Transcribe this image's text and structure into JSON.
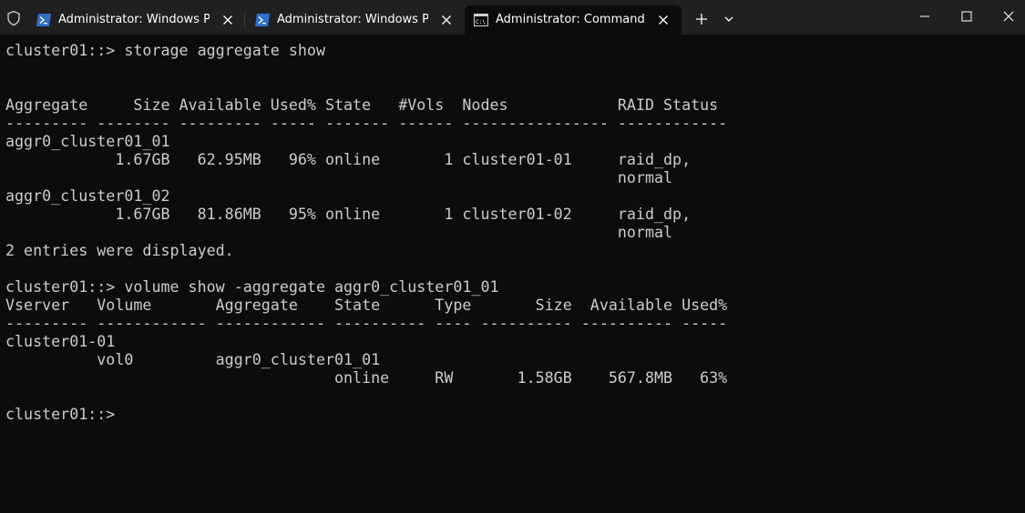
{
  "tabs": [
    {
      "title": "Administrator: Windows PowerShell",
      "icon": "powershell-icon",
      "active": false
    },
    {
      "title": "Administrator: Windows PowerShell",
      "icon": "powershell-icon",
      "active": false
    },
    {
      "title": "Administrator: Command Prompt",
      "icon": "command-prompt-icon",
      "active": true
    }
  ],
  "toolbar": {
    "new_tab_icon": "plus-icon",
    "dropdown_icon": "chevron-down-icon",
    "shield_icon": "shield-icon"
  },
  "window_controls": [
    "minimize-icon",
    "maximize-icon",
    "close-icon"
  ],
  "colors": {
    "titlebar": "#202020",
    "terminal_bg": "#0c0c0c",
    "terminal_text": "#cccccc"
  },
  "terminal": {
    "lines": [
      "cluster01::> storage aggregate show",
      "",
      "",
      "Aggregate     Size Available Used% State   #Vols  Nodes            RAID Status",
      "--------- -------- --------- ----- ------- ------ ---------------- ------------",
      "aggr0_cluster01_01",
      "            1.67GB   62.95MB   96% online       1 cluster01-01     raid_dp,",
      "                                                                   normal",
      "aggr0_cluster01_02",
      "            1.67GB   81.86MB   95% online       1 cluster01-02     raid_dp,",
      "                                                                   normal",
      "2 entries were displayed.",
      "",
      "cluster01::> volume show -aggregate aggr0_cluster01_01",
      "Vserver   Volume       Aggregate    State      Type       Size  Available Used%",
      "--------- ------------ ------------ ---------- ---- ---------- ---------- -----",
      "cluster01-01",
      "          vol0         aggr0_cluster01_01",
      "                                    online     RW       1.58GB    567.8MB   63%",
      "",
      "cluster01::>"
    ]
  }
}
